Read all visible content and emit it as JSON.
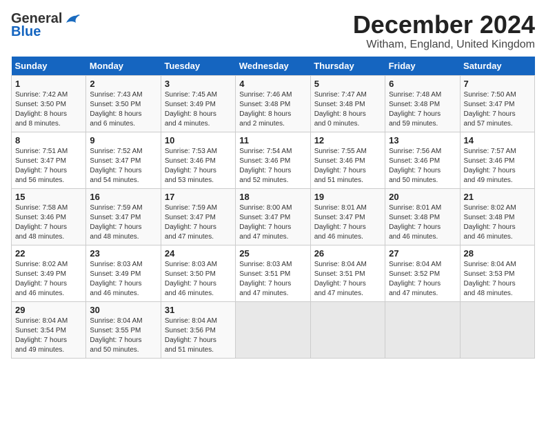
{
  "logo": {
    "line1": "General",
    "line2": "Blue"
  },
  "title": "December 2024",
  "location": "Witham, England, United Kingdom",
  "days_header": [
    "Sunday",
    "Monday",
    "Tuesday",
    "Wednesday",
    "Thursday",
    "Friday",
    "Saturday"
  ],
  "weeks": [
    [
      {
        "day": "1",
        "sunrise": "Sunrise: 7:42 AM",
        "sunset": "Sunset: 3:50 PM",
        "daylight": "Daylight: 8 hours and 8 minutes."
      },
      {
        "day": "2",
        "sunrise": "Sunrise: 7:43 AM",
        "sunset": "Sunset: 3:50 PM",
        "daylight": "Daylight: 8 hours and 6 minutes."
      },
      {
        "day": "3",
        "sunrise": "Sunrise: 7:45 AM",
        "sunset": "Sunset: 3:49 PM",
        "daylight": "Daylight: 8 hours and 4 minutes."
      },
      {
        "day": "4",
        "sunrise": "Sunrise: 7:46 AM",
        "sunset": "Sunset: 3:48 PM",
        "daylight": "Daylight: 8 hours and 2 minutes."
      },
      {
        "day": "5",
        "sunrise": "Sunrise: 7:47 AM",
        "sunset": "Sunset: 3:48 PM",
        "daylight": "Daylight: 8 hours and 0 minutes."
      },
      {
        "day": "6",
        "sunrise": "Sunrise: 7:48 AM",
        "sunset": "Sunset: 3:48 PM",
        "daylight": "Daylight: 7 hours and 59 minutes."
      },
      {
        "day": "7",
        "sunrise": "Sunrise: 7:50 AM",
        "sunset": "Sunset: 3:47 PM",
        "daylight": "Daylight: 7 hours and 57 minutes."
      }
    ],
    [
      {
        "day": "8",
        "sunrise": "Sunrise: 7:51 AM",
        "sunset": "Sunset: 3:47 PM",
        "daylight": "Daylight: 7 hours and 56 minutes."
      },
      {
        "day": "9",
        "sunrise": "Sunrise: 7:52 AM",
        "sunset": "Sunset: 3:47 PM",
        "daylight": "Daylight: 7 hours and 54 minutes."
      },
      {
        "day": "10",
        "sunrise": "Sunrise: 7:53 AM",
        "sunset": "Sunset: 3:46 PM",
        "daylight": "Daylight: 7 hours and 53 minutes."
      },
      {
        "day": "11",
        "sunrise": "Sunrise: 7:54 AM",
        "sunset": "Sunset: 3:46 PM",
        "daylight": "Daylight: 7 hours and 52 minutes."
      },
      {
        "day": "12",
        "sunrise": "Sunrise: 7:55 AM",
        "sunset": "Sunset: 3:46 PM",
        "daylight": "Daylight: 7 hours and 51 minutes."
      },
      {
        "day": "13",
        "sunrise": "Sunrise: 7:56 AM",
        "sunset": "Sunset: 3:46 PM",
        "daylight": "Daylight: 7 hours and 50 minutes."
      },
      {
        "day": "14",
        "sunrise": "Sunrise: 7:57 AM",
        "sunset": "Sunset: 3:46 PM",
        "daylight": "Daylight: 7 hours and 49 minutes."
      }
    ],
    [
      {
        "day": "15",
        "sunrise": "Sunrise: 7:58 AM",
        "sunset": "Sunset: 3:46 PM",
        "daylight": "Daylight: 7 hours and 48 minutes."
      },
      {
        "day": "16",
        "sunrise": "Sunrise: 7:59 AM",
        "sunset": "Sunset: 3:47 PM",
        "daylight": "Daylight: 7 hours and 48 minutes."
      },
      {
        "day": "17",
        "sunrise": "Sunrise: 7:59 AM",
        "sunset": "Sunset: 3:47 PM",
        "daylight": "Daylight: 7 hours and 47 minutes."
      },
      {
        "day": "18",
        "sunrise": "Sunrise: 8:00 AM",
        "sunset": "Sunset: 3:47 PM",
        "daylight": "Daylight: 7 hours and 47 minutes."
      },
      {
        "day": "19",
        "sunrise": "Sunrise: 8:01 AM",
        "sunset": "Sunset: 3:47 PM",
        "daylight": "Daylight: 7 hours and 46 minutes."
      },
      {
        "day": "20",
        "sunrise": "Sunrise: 8:01 AM",
        "sunset": "Sunset: 3:48 PM",
        "daylight": "Daylight: 7 hours and 46 minutes."
      },
      {
        "day": "21",
        "sunrise": "Sunrise: 8:02 AM",
        "sunset": "Sunset: 3:48 PM",
        "daylight": "Daylight: 7 hours and 46 minutes."
      }
    ],
    [
      {
        "day": "22",
        "sunrise": "Sunrise: 8:02 AM",
        "sunset": "Sunset: 3:49 PM",
        "daylight": "Daylight: 7 hours and 46 minutes."
      },
      {
        "day": "23",
        "sunrise": "Sunrise: 8:03 AM",
        "sunset": "Sunset: 3:49 PM",
        "daylight": "Daylight: 7 hours and 46 minutes."
      },
      {
        "day": "24",
        "sunrise": "Sunrise: 8:03 AM",
        "sunset": "Sunset: 3:50 PM",
        "daylight": "Daylight: 7 hours and 46 minutes."
      },
      {
        "day": "25",
        "sunrise": "Sunrise: 8:03 AM",
        "sunset": "Sunset: 3:51 PM",
        "daylight": "Daylight: 7 hours and 47 minutes."
      },
      {
        "day": "26",
        "sunrise": "Sunrise: 8:04 AM",
        "sunset": "Sunset: 3:51 PM",
        "daylight": "Daylight: 7 hours and 47 minutes."
      },
      {
        "day": "27",
        "sunrise": "Sunrise: 8:04 AM",
        "sunset": "Sunset: 3:52 PM",
        "daylight": "Daylight: 7 hours and 47 minutes."
      },
      {
        "day": "28",
        "sunrise": "Sunrise: 8:04 AM",
        "sunset": "Sunset: 3:53 PM",
        "daylight": "Daylight: 7 hours and 48 minutes."
      }
    ],
    [
      {
        "day": "29",
        "sunrise": "Sunrise: 8:04 AM",
        "sunset": "Sunset: 3:54 PM",
        "daylight": "Daylight: 7 hours and 49 minutes."
      },
      {
        "day": "30",
        "sunrise": "Sunrise: 8:04 AM",
        "sunset": "Sunset: 3:55 PM",
        "daylight": "Daylight: 7 hours and 50 minutes."
      },
      {
        "day": "31",
        "sunrise": "Sunrise: 8:04 AM",
        "sunset": "Sunset: 3:56 PM",
        "daylight": "Daylight: 7 hours and 51 minutes."
      },
      null,
      null,
      null,
      null
    ]
  ]
}
